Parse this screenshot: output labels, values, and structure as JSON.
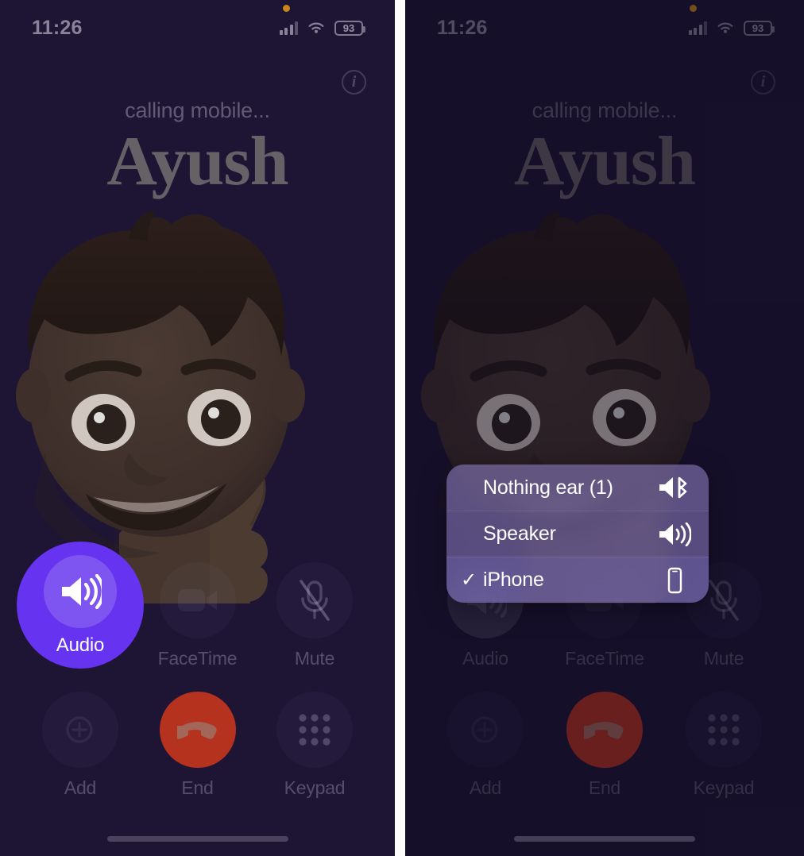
{
  "screens": [
    {
      "id": "call-screen-default",
      "status_bar": {
        "time": "11:26",
        "battery_percent": "93",
        "cellular_icon": "cellular-bars-icon",
        "wifi_icon": "wifi-icon",
        "battery_icon": "battery-icon",
        "privacy_indicator_icon": "microphone-in-use-dot"
      },
      "info_button_glyph": "i",
      "caller": {
        "status": "calling mobile...",
        "name": "Ayush"
      },
      "controls": [
        {
          "id": "audio",
          "label": "Audio",
          "icon": "speaker-wave-icon",
          "state": "active"
        },
        {
          "id": "facetime",
          "label": "FaceTime",
          "icon": "video-camera-icon",
          "state": "normal"
        },
        {
          "id": "mute",
          "label": "Mute",
          "icon": "microphone-slash-icon",
          "state": "normal"
        },
        {
          "id": "add",
          "label": "Add",
          "icon": "add-call-icon",
          "state": "normal"
        },
        {
          "id": "end",
          "label": "End",
          "icon": "phone-down-icon",
          "state": "end"
        },
        {
          "id": "keypad",
          "label": "Keypad",
          "icon": "keypad-grid-icon",
          "state": "normal"
        }
      ],
      "route_menu": null
    },
    {
      "id": "call-screen-audio-routes",
      "status_bar": {
        "time": "11:26",
        "battery_percent": "93",
        "cellular_icon": "cellular-bars-icon",
        "wifi_icon": "wifi-icon",
        "battery_icon": "battery-icon",
        "privacy_indicator_icon": "microphone-in-use-dot"
      },
      "info_button_glyph": "i",
      "caller": {
        "status": "calling mobile...",
        "name": "Ayush"
      },
      "controls": [
        {
          "id": "audio",
          "label": "Audio",
          "icon": "speaker-wave-icon",
          "state": "open"
        },
        {
          "id": "facetime",
          "label": "FaceTime",
          "icon": "video-camera-icon",
          "state": "normal"
        },
        {
          "id": "mute",
          "label": "Mute",
          "icon": "microphone-slash-icon",
          "state": "normal"
        },
        {
          "id": "add",
          "label": "Add",
          "icon": "add-call-icon",
          "state": "normal"
        },
        {
          "id": "end",
          "label": "End",
          "icon": "phone-down-icon",
          "state": "end"
        },
        {
          "id": "keypad",
          "label": "Keypad",
          "icon": "keypad-grid-icon",
          "state": "normal"
        }
      ],
      "route_menu": {
        "items": [
          {
            "label": "Nothing ear (1)",
            "icon": "speaker-bluetooth-icon",
            "selected": false,
            "check": ""
          },
          {
            "label": "Speaker",
            "icon": "speaker-wave-icon",
            "selected": false,
            "check": ""
          },
          {
            "label": "iPhone",
            "icon": "iphone-icon",
            "selected": true,
            "check": "✓"
          }
        ]
      }
    }
  ],
  "colors": {
    "background": "#1e1535",
    "accent_purple": "#6633f0",
    "end_red": "#b5321f",
    "menu_bg": "#7e70b2",
    "privacy_dot": "#c8861a",
    "text_dim": "#bebacd"
  }
}
